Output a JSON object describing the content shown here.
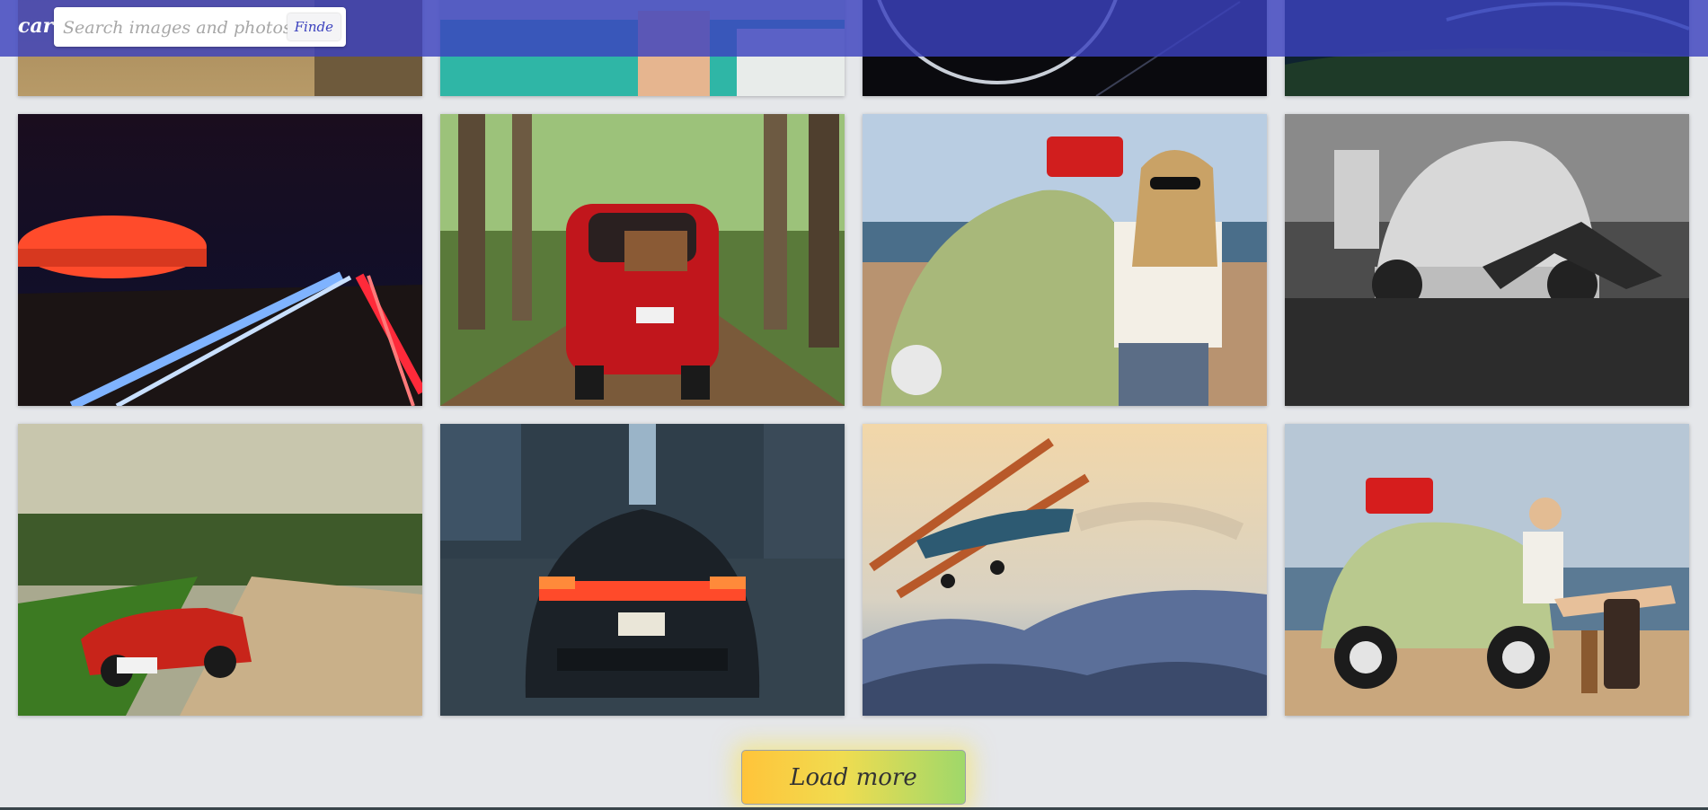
{
  "header": {
    "brand": "car",
    "search_placeholder": "Search images and photos",
    "search_value": "",
    "search_button": "Finde",
    "background_color": "#3c42be"
  },
  "gallery": {
    "tiles": [
      {
        "subject": "warm-road-photo"
      },
      {
        "subject": "vintage-car-interior-photo"
      },
      {
        "subject": "speedometer-gauge-photo"
      },
      {
        "subject": "night-highway-aerial-photo"
      },
      {
        "subject": "red-stadium-light-trails-photo"
      },
      {
        "subject": "red-fiat-forest-road-photo"
      },
      {
        "subject": "woman-green-beetle-beach-photo"
      },
      {
        "subject": "bw-beetle-garage-photo"
      },
      {
        "subject": "red-convertible-dirt-road-photo"
      },
      {
        "subject": "porsche-rainy-city-photo"
      },
      {
        "subject": "biplane-mountains-photo"
      },
      {
        "subject": "beetle-woman-beach-wide-photo"
      }
    ]
  },
  "footer": {
    "load_more_label": "Load more"
  }
}
